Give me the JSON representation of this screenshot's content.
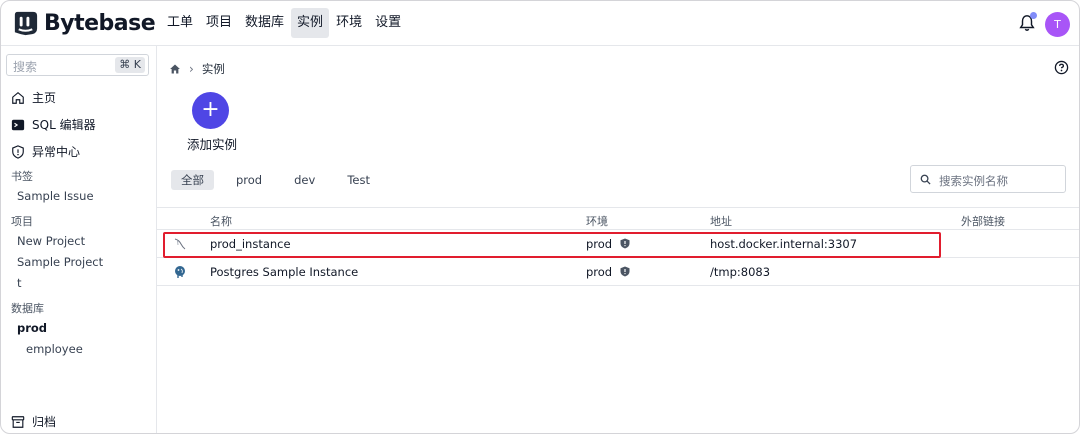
{
  "app": {
    "name": "Bytebase"
  },
  "topnav": [
    {
      "label": "工单",
      "active": false
    },
    {
      "label": "项目",
      "active": false
    },
    {
      "label": "数据库",
      "active": false
    },
    {
      "label": "实例",
      "active": true
    },
    {
      "label": "环境",
      "active": false
    },
    {
      "label": "设置",
      "active": false
    }
  ],
  "user": {
    "avatar_letter": "T"
  },
  "sidebar": {
    "search_placeholder": "搜索",
    "search_shortcut": "⌘ K",
    "nav": [
      {
        "label": "主页",
        "icon": "home-icon"
      },
      {
        "label": "SQL 编辑器",
        "icon": "terminal-icon"
      },
      {
        "label": "异常中心",
        "icon": "shield-icon"
      }
    ],
    "bookmarks_heading": "书签",
    "bookmarks": [
      "Sample Issue"
    ],
    "projects_heading": "项目",
    "projects": [
      "New Project",
      "Sample Project",
      "t"
    ],
    "databases_heading": "数据库",
    "db_env": "prod",
    "db_name": "employee",
    "archive_label": "归档"
  },
  "breadcrumb": {
    "current": "实例"
  },
  "add_instance": {
    "icon": "+",
    "label": "添加实例"
  },
  "tabs": [
    {
      "label": "全部",
      "active": true
    },
    {
      "label": "prod",
      "active": false
    },
    {
      "label": "dev",
      "active": false
    },
    {
      "label": "Test",
      "active": false
    }
  ],
  "filter": {
    "placeholder": "搜索实例名称"
  },
  "table": {
    "headers": [
      "名称",
      "环境",
      "地址",
      "外部链接"
    ],
    "rows": [
      {
        "icon": "mysql-icon",
        "name": "prod_instance",
        "env": "prod",
        "address": "host.docker.internal:3307",
        "link": "",
        "highlighted": true
      },
      {
        "icon": "postgres-icon",
        "name": "Postgres Sample Instance",
        "env": "prod",
        "address": "/tmp:8083",
        "link": "",
        "highlighted": false
      }
    ]
  },
  "colors": {
    "accent": "#4f46e5",
    "avatar": "#a855f7",
    "highlight": "#e11d2e",
    "bell_dot": "#818cf8"
  }
}
